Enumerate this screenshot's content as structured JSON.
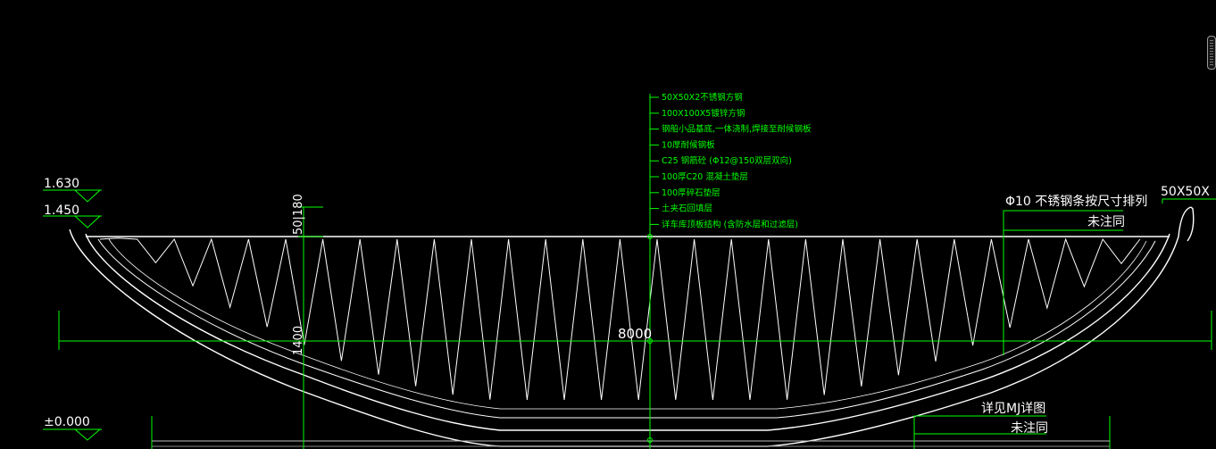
{
  "drawing": {
    "colors": {
      "background": "#000000",
      "green": "#00ff00",
      "white": "#ffffff"
    },
    "elevations": [
      "1.630",
      "1.450",
      "±0.000"
    ],
    "layer_labels": [
      "50X50X2不锈钢方钢",
      "100X100X5镀锌方钢",
      "钢船小品基底,一体浇制,焊接至耐候钢板",
      "10厚耐候钢板",
      "C25 钢筋砼 (Φ12@150双层双向)",
      "100厚C20 混凝土垫层",
      "100厚碎石垫层",
      "土夹石回填层",
      "详车库顶板结构 (含防水层和过滤层)"
    ],
    "dimensions": {
      "top_thickness": "50|180",
      "depth": "1400",
      "width": "8000"
    },
    "notes": {
      "right_callout": "Φ10 不锈钢条按尺寸排列",
      "right_callout_sub": "未注同",
      "corner_label": "50X50X",
      "detail_ref": "详见MJ详图",
      "detail_ref_sub": "未注同"
    }
  },
  "ui": {
    "scrollbar": "vertical-scrollbar"
  }
}
